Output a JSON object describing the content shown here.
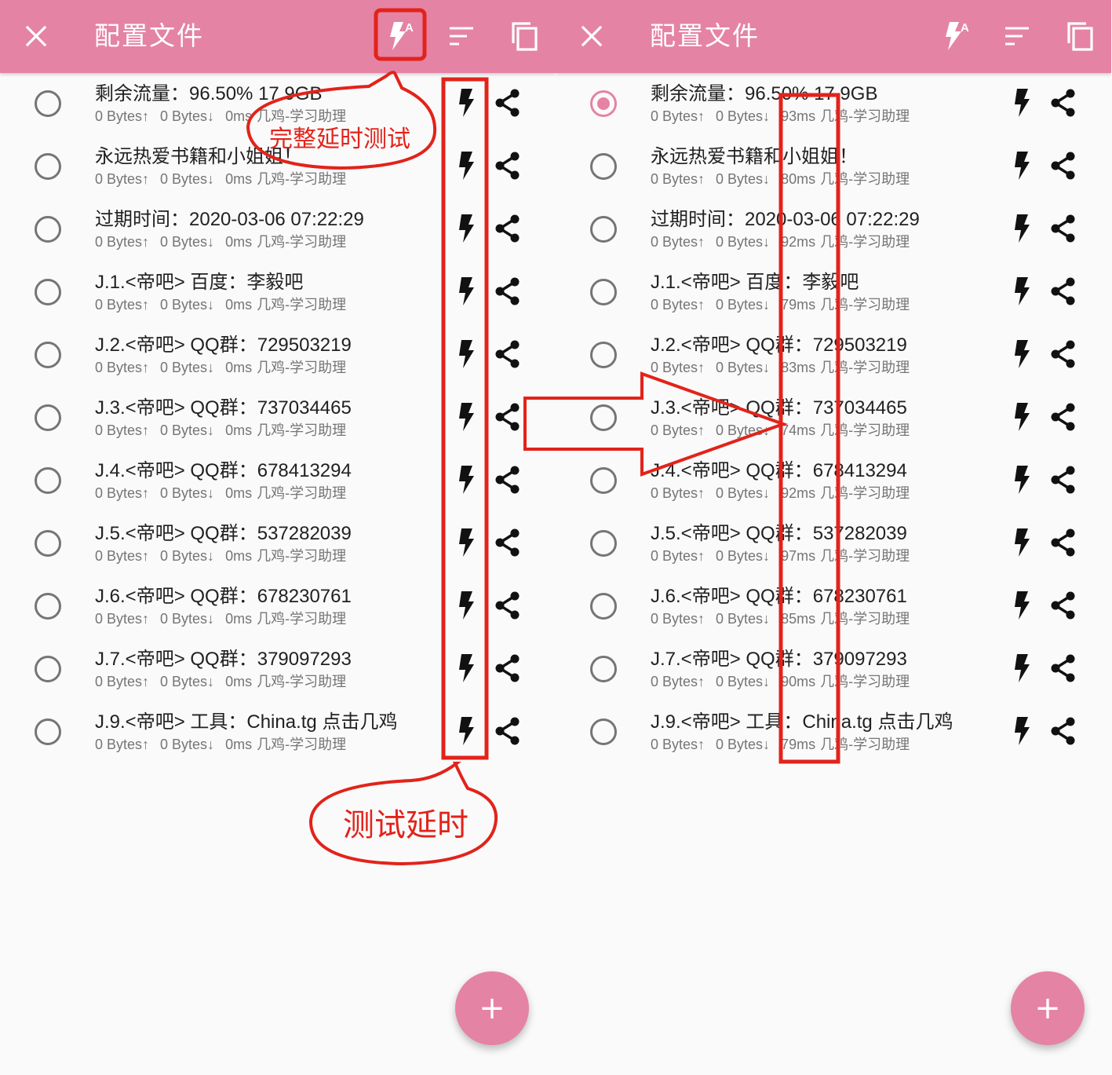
{
  "colors": {
    "accent": "#e583a4",
    "annotation_red": "#e2231a"
  },
  "toolbar": {
    "title": "配置文件",
    "icons": [
      "close-icon",
      "test-all-latency-icon",
      "sort-icon",
      "copy-icon"
    ]
  },
  "fab": {
    "label": "+"
  },
  "annotations": {
    "full_latency_test": "完整延时测试",
    "test_latency": "测试延时"
  },
  "screens": {
    "left": {
      "selected_index": -1,
      "items": [
        {
          "name": "剩余流量：96.50% 17.9GB",
          "up": "0 Bytes↑",
          "down": "0 Bytes↓",
          "latency": "0ms",
          "group": "几鸡-学习助理"
        },
        {
          "name": "永远热爱书籍和小姐姐！",
          "up": "0 Bytes↑",
          "down": "0 Bytes↓",
          "latency": "0ms",
          "group": "几鸡-学习助理"
        },
        {
          "name": "过期时间：2020-03-06 07:22:29",
          "up": "0 Bytes↑",
          "down": "0 Bytes↓",
          "latency": "0ms",
          "group": "几鸡-学习助理"
        },
        {
          "name": "J.1.<帝吧> 百度：李毅吧",
          "up": "0 Bytes↑",
          "down": "0 Bytes↓",
          "latency": "0ms",
          "group": "几鸡-学习助理"
        },
        {
          "name": "J.2.<帝吧> QQ群：729503219",
          "up": "0 Bytes↑",
          "down": "0 Bytes↓",
          "latency": "0ms",
          "group": "几鸡-学习助理"
        },
        {
          "name": "J.3.<帝吧> QQ群：737034465",
          "up": "0 Bytes↑",
          "down": "0 Bytes↓",
          "latency": "0ms",
          "group": "几鸡-学习助理"
        },
        {
          "name": "J.4.<帝吧> QQ群：678413294",
          "up": "0 Bytes↑",
          "down": "0 Bytes↓",
          "latency": "0ms",
          "group": "几鸡-学习助理"
        },
        {
          "name": "J.5.<帝吧> QQ群：537282039",
          "up": "0 Bytes↑",
          "down": "0 Bytes↓",
          "latency": "0ms",
          "group": "几鸡-学习助理"
        },
        {
          "name": "J.6.<帝吧> QQ群：678230761",
          "up": "0 Bytes↑",
          "down": "0 Bytes↓",
          "latency": "0ms",
          "group": "几鸡-学习助理"
        },
        {
          "name": "J.7.<帝吧> QQ群：379097293",
          "up": "0 Bytes↑",
          "down": "0 Bytes↓",
          "latency": "0ms",
          "group": "几鸡-学习助理"
        },
        {
          "name": "J.9.<帝吧> 工具：China.tg 点击几鸡",
          "up": "0 Bytes↑",
          "down": "0 Bytes↓",
          "latency": "0ms",
          "group": "几鸡-学习助理"
        }
      ]
    },
    "right": {
      "selected_index": 0,
      "items": [
        {
          "name": "剩余流量：96.50% 17.9GB",
          "up": "0 Bytes↑",
          "down": "0 Bytes↓",
          "latency": "93ms",
          "group": "几鸡-学习助理"
        },
        {
          "name": "永远热爱书籍和小姐姐！",
          "up": "0 Bytes↑",
          "down": "0 Bytes↓",
          "latency": "80ms",
          "group": "几鸡-学习助理"
        },
        {
          "name": "过期时间：2020-03-06 07:22:29",
          "up": "0 Bytes↑",
          "down": "0 Bytes↓",
          "latency": "92ms",
          "group": "几鸡-学习助理"
        },
        {
          "name": "J.1.<帝吧> 百度：李毅吧",
          "up": "0 Bytes↑",
          "down": "0 Bytes↓",
          "latency": "79ms",
          "group": "几鸡-学习助理"
        },
        {
          "name": "J.2.<帝吧> QQ群：729503219",
          "up": "0 Bytes↑",
          "down": "0 Bytes↓",
          "latency": "83ms",
          "group": "几鸡-学习助理"
        },
        {
          "name": "J.3.<帝吧> QQ群：737034465",
          "up": "0 Bytes↑",
          "down": "0 Bytes↓",
          "latency": "74ms",
          "group": "几鸡-学习助理"
        },
        {
          "name": "J.4.<帝吧> QQ群：678413294",
          "up": "0 Bytes↑",
          "down": "0 Bytes↓",
          "latency": "92ms",
          "group": "几鸡-学习助理"
        },
        {
          "name": "J.5.<帝吧> QQ群：537282039",
          "up": "0 Bytes↑",
          "down": "0 Bytes↓",
          "latency": "97ms",
          "group": "几鸡-学习助理"
        },
        {
          "name": "J.6.<帝吧> QQ群：678230761",
          "up": "0 Bytes↑",
          "down": "0 Bytes↓",
          "latency": "85ms",
          "group": "几鸡-学习助理"
        },
        {
          "name": "J.7.<帝吧> QQ群：379097293",
          "up": "0 Bytes↑",
          "down": "0 Bytes↓",
          "latency": "90ms",
          "group": "几鸡-学习助理"
        },
        {
          "name": "J.9.<帝吧> 工具：China.tg 点击几鸡",
          "up": "0 Bytes↑",
          "down": "0 Bytes↓",
          "latency": "79ms",
          "group": "几鸡-学习助理"
        }
      ]
    }
  }
}
